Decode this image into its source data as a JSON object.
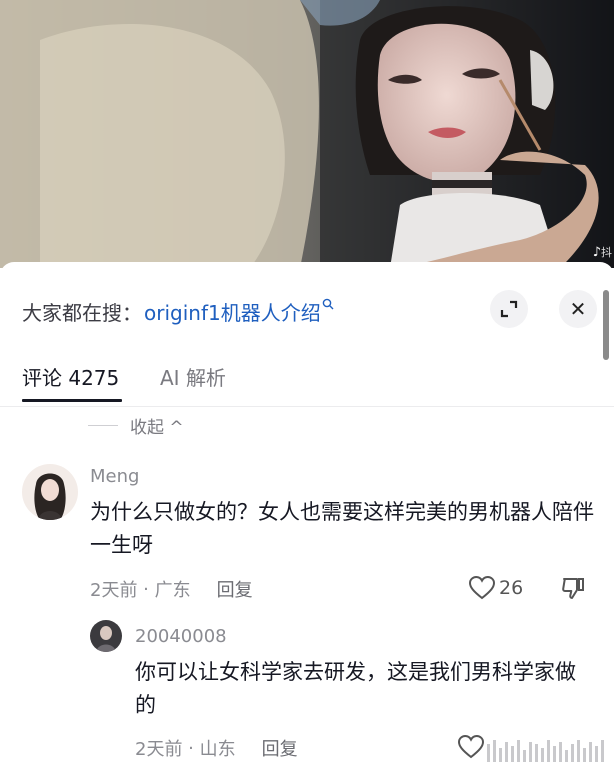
{
  "search": {
    "prefix": "大家都在搜：",
    "query": "originf1机器人介绍",
    "query_icon": "search-icon"
  },
  "controls": {
    "expand_icon": "expand-icon",
    "close_icon": "close-icon",
    "close_glyph": "✕"
  },
  "tabs": [
    {
      "label": "评论 4275",
      "active": true
    },
    {
      "label": "AI 解析",
      "active": false
    }
  ],
  "collapse_label": "收起 ^",
  "comments": [
    {
      "username": "Meng",
      "text": "为什么只做女的？女人也需要这样完美的男机器人陪伴一生呀",
      "time": "2天前",
      "location": "广东",
      "reply_label": "回复",
      "likes": "26"
    },
    {
      "username": "20040008",
      "text": "你可以让女科学家去研发，这是我们男科学家做的",
      "time": "2天前",
      "location": "山东",
      "reply_label": "回复"
    }
  ],
  "colors": {
    "accent_link": "#1f5fbf",
    "meta_gray": "#8a8b91",
    "text": "#161823"
  }
}
